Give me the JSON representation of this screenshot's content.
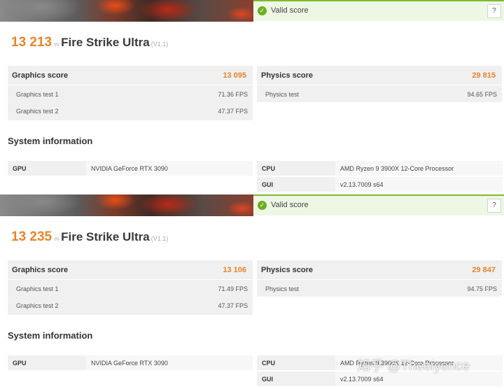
{
  "results": [
    {
      "valid_label": "Valid score",
      "help_label": "?",
      "total_score": "13 213",
      "in_word": "IN",
      "benchmark": "Fire Strike Ultra",
      "version": "(V1.1)",
      "graphics": {
        "label": "Graphics score",
        "score": "13 095",
        "tests": [
          {
            "label": "Graphics test 1",
            "value": "71.36 FPS"
          },
          {
            "label": "Graphics test 2",
            "value": "47.37 FPS"
          }
        ]
      },
      "physics": {
        "label": "Physics score",
        "score": "29 815",
        "tests": [
          {
            "label": "Physics test",
            "value": "94.65 FPS"
          }
        ]
      },
      "system_info_title": "System information",
      "system": {
        "gpu_label": "GPU",
        "gpu_value": "NVIDIA GeForce RTX 3090",
        "cpu_label": "CPU",
        "cpu_value": "AMD Ryzen 9 3900X 12-Core Processor",
        "gui_label": "GUI",
        "gui_value": "v2.13.7009 s64"
      }
    },
    {
      "valid_label": "Valid score",
      "help_label": "?",
      "total_score": "13 235",
      "in_word": "IN",
      "benchmark": "Fire Strike Ultra",
      "version": "(V1.1)",
      "graphics": {
        "label": "Graphics score",
        "score": "13 106",
        "tests": [
          {
            "label": "Graphics test 1",
            "value": "71.49 FPS"
          },
          {
            "label": "Graphics test 2",
            "value": "47.37 FPS"
          }
        ]
      },
      "physics": {
        "label": "Physics score",
        "score": "29 847",
        "tests": [
          {
            "label": "Physics test",
            "value": "94.75 FPS"
          }
        ]
      },
      "system_info_title": "System information",
      "system": {
        "gpu_label": "GPU",
        "gpu_value": "NVIDIA GeForce RTX 3090",
        "cpu_label": "CPU",
        "cpu_value": "AMD Ryzen 9 3900X 12-Core Processor",
        "gui_label": "GUI",
        "gui_value": "v2.13.7009 s64"
      }
    }
  ],
  "icons": {
    "valid": "check-circle-icon"
  },
  "colors": {
    "score": "#e8842a",
    "valid_bar": "#eef6e4",
    "valid_border": "#7dbb2e",
    "box_bg": "#f0f0f0"
  },
  "watermark": "知乎 @Theeiyence"
}
